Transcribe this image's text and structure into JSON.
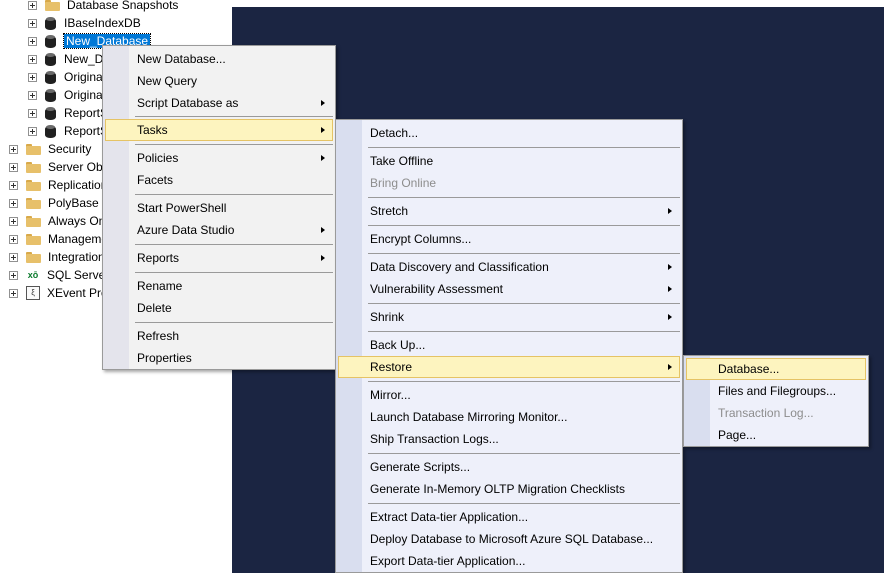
{
  "tree": {
    "items": [
      {
        "label": "Database Snapshots",
        "icon": "folder-icon"
      },
      {
        "label": "IBaseIndexDB",
        "icon": "database-icon"
      },
      {
        "label": "New_Database",
        "icon": "database-icon",
        "selected": true
      },
      {
        "label": "New_D",
        "icon": "database-icon"
      },
      {
        "label": "Origina",
        "icon": "database-icon"
      },
      {
        "label": "Origina",
        "icon": "database-icon"
      },
      {
        "label": "ReportS",
        "icon": "database-icon"
      },
      {
        "label": "ReportS",
        "icon": "database-icon"
      },
      {
        "label": "Security",
        "icon": "folder-icon"
      },
      {
        "label": "Server Obje",
        "icon": "folder-icon"
      },
      {
        "label": "Replication",
        "icon": "folder-icon"
      },
      {
        "label": "PolyBase",
        "icon": "folder-icon"
      },
      {
        "label": "Always On",
        "icon": "folder-icon"
      },
      {
        "label": "Manageme",
        "icon": "folder-icon"
      },
      {
        "label": "Integration",
        "icon": "folder-icon"
      },
      {
        "label": "SQL Server",
        "icon": "sql-agent-icon",
        "icon_glyph": "xō"
      },
      {
        "label": "XEvent Pro",
        "icon": "xevent-icon",
        "icon_glyph": "ξ"
      }
    ]
  },
  "context_menu": {
    "new_database": "New Database...",
    "new_query": "New Query",
    "script_database_as": "Script Database as",
    "tasks": "Tasks",
    "policies": "Policies",
    "facets": "Facets",
    "start_powershell": "Start PowerShell",
    "azure_data_studio": "Azure Data Studio",
    "reports": "Reports",
    "rename": "Rename",
    "delete": "Delete",
    "refresh": "Refresh",
    "properties": "Properties"
  },
  "tasks_menu": {
    "detach": "Detach...",
    "take_offline": "Take Offline",
    "bring_online": "Bring Online",
    "stretch": "Stretch",
    "encrypt_columns": "Encrypt Columns...",
    "data_discovery": "Data Discovery and Classification",
    "vulnerability_assessment": "Vulnerability Assessment",
    "shrink": "Shrink",
    "back_up": "Back Up...",
    "restore": "Restore",
    "mirror": "Mirror...",
    "launch_mirroring_monitor": "Launch Database Mirroring Monitor...",
    "ship_transaction_logs": "Ship Transaction Logs...",
    "generate_scripts": "Generate Scripts...",
    "generate_inmemory_checklists": "Generate In-Memory OLTP Migration Checklists",
    "extract_data_tier": "Extract Data-tier Application...",
    "deploy_to_azure": "Deploy Database to Microsoft Azure SQL Database...",
    "export_data_tier": "Export Data-tier Application..."
  },
  "restore_menu": {
    "database": "Database...",
    "files_and_filegroups": "Files and Filegroups...",
    "transaction_log": "Transaction Log...",
    "page": "Page..."
  },
  "colors": {
    "highlight": "#fdf4bf",
    "highlight_border": "#e5c365",
    "selection": "#0078d7",
    "background_panel": "#1b2542"
  }
}
